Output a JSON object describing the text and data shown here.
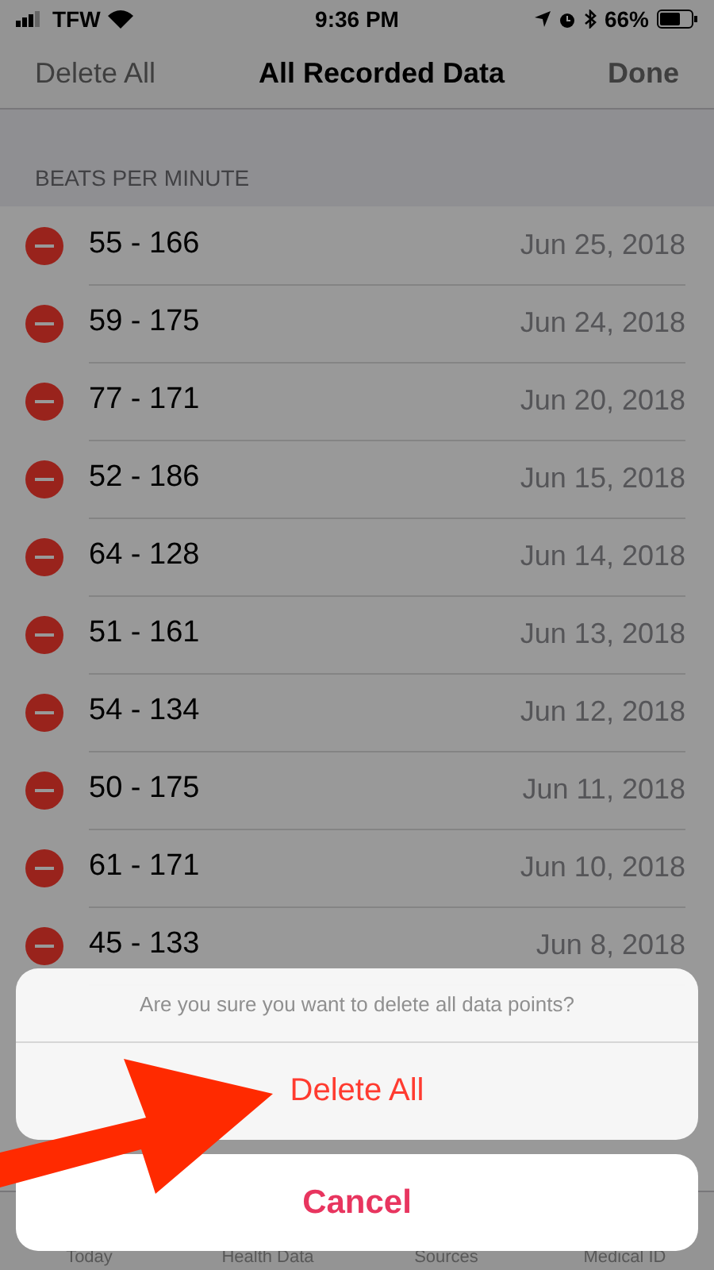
{
  "status_bar": {
    "carrier": "TFW",
    "time": "9:36 PM",
    "battery": "66%"
  },
  "nav": {
    "left": "Delete All",
    "title": "All Recorded Data",
    "right": "Done"
  },
  "section": "BEATS PER MINUTE",
  "rows": [
    {
      "value": "55 - 166",
      "date": "Jun 25, 2018"
    },
    {
      "value": "59 - 175",
      "date": "Jun 24, 2018"
    },
    {
      "value": "77 - 171",
      "date": "Jun 20, 2018"
    },
    {
      "value": "52 - 186",
      "date": "Jun 15, 2018"
    },
    {
      "value": "64 - 128",
      "date": "Jun 14, 2018"
    },
    {
      "value": "51 - 161",
      "date": "Jun 13, 2018"
    },
    {
      "value": "54 - 134",
      "date": "Jun 12, 2018"
    },
    {
      "value": "50 - 175",
      "date": "Jun 11, 2018"
    },
    {
      "value": "61 - 171",
      "date": "Jun 10, 2018"
    },
    {
      "value": "45 - 133",
      "date": "Jun 8, 2018"
    }
  ],
  "tabs": [
    {
      "label": "Today"
    },
    {
      "label": "Health Data"
    },
    {
      "label": "Sources"
    },
    {
      "label": "Medical ID"
    }
  ],
  "action_sheet": {
    "message": "Are you sure you want to delete all data points?",
    "actions": [
      {
        "label": "Delete All",
        "kind": "destructive"
      }
    ],
    "cancel": "Cancel"
  }
}
